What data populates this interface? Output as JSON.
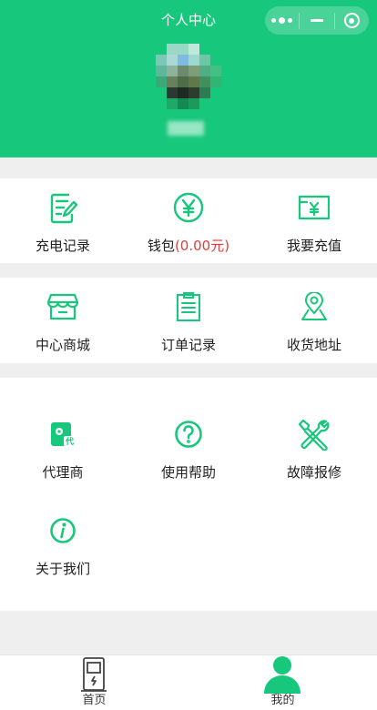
{
  "header": {
    "title": "个人中心",
    "menu_icon": "more-dots-icon",
    "minimize_icon": "minimize-icon",
    "close_icon": "target-circle-icon",
    "theme_color": "#17c77b"
  },
  "profile": {
    "avatar_icon": "pixelated-avatar"
  },
  "menu_row1": [
    {
      "label": "充电记录",
      "icon": "charge-record-icon"
    },
    {
      "label": "钱包",
      "amount": "(0.00元)",
      "icon": "wallet-yen-icon"
    },
    {
      "label": "我要充值",
      "icon": "recharge-icon"
    }
  ],
  "menu_row2": [
    {
      "label": "中心商城",
      "icon": "shop-icon"
    },
    {
      "label": "订单记录",
      "icon": "clipboard-icon"
    },
    {
      "label": "收货地址",
      "icon": "location-pin-icon"
    }
  ],
  "menu_row3": [
    {
      "label": "代理商",
      "icon": "agent-icon"
    },
    {
      "label": "使用帮助",
      "icon": "help-icon"
    },
    {
      "label": "故障报修",
      "icon": "repair-tools-icon"
    },
    {
      "label": "关于我们",
      "icon": "info-icon"
    }
  ],
  "tabbar": {
    "tabs": [
      {
        "label": "首页",
        "icon": "charger-station-icon",
        "active": false
      },
      {
        "label": "我的",
        "icon": "user-icon",
        "active": true
      }
    ]
  },
  "colors": {
    "accent": "#17c77b",
    "amount": "#e63b3b",
    "background": "#efefef"
  }
}
